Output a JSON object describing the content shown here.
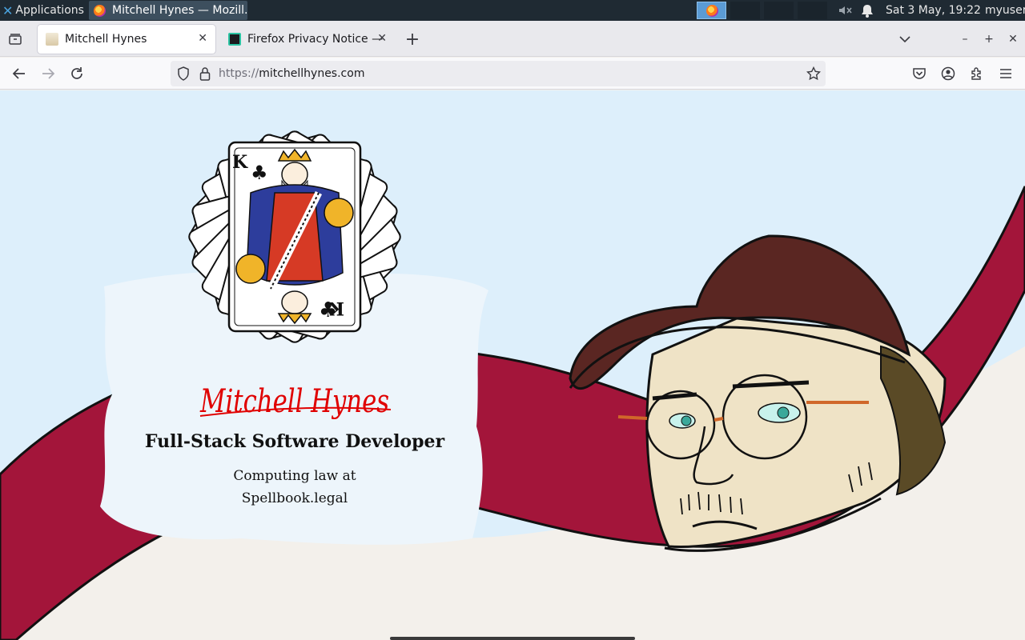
{
  "os_panel": {
    "applications_label": "Applications",
    "task_title": "Mitchell Hynes — Mozill...",
    "clock": "Sat  3 May, 19:22",
    "user": "myuser"
  },
  "tabs": [
    {
      "title": "Mitchell Hynes",
      "active": true
    },
    {
      "title": "Firefox Privacy Notice —",
      "active": false
    }
  ],
  "navbar": {
    "url_protocol": "https://",
    "url_host": "mitchellhynes.com"
  },
  "hero": {
    "signature": "Mitchell Hynes",
    "job_title": "Full-Stack Software Developer",
    "subtitle_line1": "Computing law at",
    "subtitle_line2": "Spellbook.legal"
  },
  "colors": {
    "sky": "#ddeffb",
    "ribbon": "#a3153a",
    "ground": "#f3f0eb",
    "signature": "#e00000",
    "cap": "#5a2622",
    "skin": "#efe3c6"
  },
  "icons": [
    "applications-x-icon",
    "firefox-icon",
    "volume-muted-icon",
    "bell-icon",
    "tab-overview-icon",
    "tab-close-icon",
    "new-tab-icon",
    "list-all-tabs-icon",
    "minimize-icon",
    "maximize-icon",
    "window-close-icon",
    "back-icon",
    "forward-icon",
    "reload-icon",
    "shield-icon",
    "lock-icon",
    "bookmark-star-icon",
    "pocket-icon",
    "account-icon",
    "extensions-icon",
    "menu-icon"
  ]
}
